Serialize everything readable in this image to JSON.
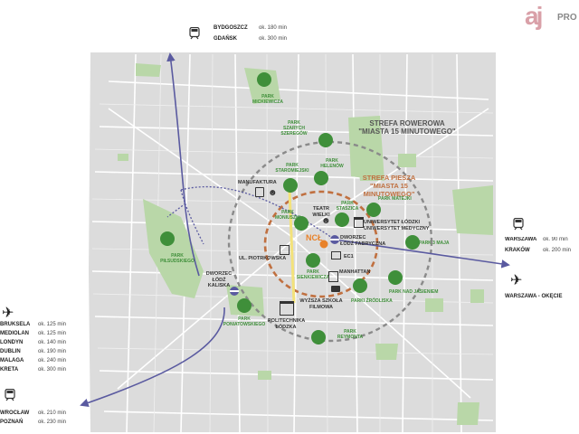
{
  "brand": {
    "logo_letters": "aj",
    "text": "PRO"
  },
  "colors": {
    "accent": "#5a5aa0",
    "logo": "#d9a0a8",
    "park_green": "#3f8f3a",
    "bike_zone": "#8a8a8a",
    "walk_zone": "#c07040",
    "center": "#e8822a"
  },
  "zones": {
    "bike": {
      "line1": "STREFA ROWEROWA",
      "line2": "\"MIASTA 15 MINUTOWEGO\""
    },
    "walk": {
      "line1": "STREFA PIESZA",
      "line2": "\"MIASTA 15 MINUTOWEGO\""
    }
  },
  "center_label": "NCŁ",
  "parks": {
    "mickiewicza": [
      "PARK",
      "MICKIEWICZA"
    ],
    "szarych": [
      "PARK",
      "SZARYCH SZEREGÓW"
    ],
    "staromiejski": [
      "PARK",
      "STAROMIEJSKI"
    ],
    "helenow": [
      "PARK",
      "HELENÓW"
    ],
    "matejki": "PARK MATEJKI",
    "staszica": [
      "PARK",
      "STASZICA"
    ],
    "moniuszki": [
      "PARK",
      "MONIUSZKI"
    ],
    "poniatowskiego": [
      "PARK",
      "PONIATOWSKIEGO"
    ],
    "sienkiewicza": [
      "PARK",
      "SIENKIEWICZA"
    ],
    "trzeciego_maja": "PARK 3 MAJA",
    "zrodliska": "PARKI ŹRÓDLISKA",
    "jesienem": "PARK NAD JASIENIEM",
    "reymonta": [
      "PARK",
      "REYMONTA"
    ],
    "pilsudskiego": [
      "PARK",
      "PIŁSUDSKIEGO"
    ]
  },
  "pois": {
    "manufaktura": "MANUFAKTURA",
    "teatr": [
      "TEATR",
      "WIELKI"
    ],
    "uniwersytet": [
      "UNIWERSYTET ŁÓDZKI",
      "UNIWERSYTET MEDYCZNY"
    ],
    "dworzec_fabryczna": [
      "DWORZEC",
      "ŁÓDŹ FABRYCZNA"
    ],
    "ec1": "EC1",
    "piotrkowska": "UL. PIOTRKOWSKA",
    "manhattan": "MANHATTAN",
    "dworzec_kaliska": [
      "DWORZEC",
      "ŁÓDŹ KALISKA"
    ],
    "szkola_filmowa": [
      "WYŻSZA SZKOŁA",
      "FILMOWA"
    ],
    "politechnika": [
      "POLITECHNIKA",
      "ŁÓDZKA"
    ]
  },
  "north_train": [
    {
      "city": "BYDGOSZCZ",
      "time": "ok. 180 min"
    },
    {
      "city": "GDAŃSK",
      "time": "ok. 300 min"
    }
  ],
  "east_train": [
    {
      "city": "WARSZAWA",
      "time": "ok. 90 min"
    },
    {
      "city": "KRAKÓW",
      "time": "ok. 200 min"
    }
  ],
  "east_air": "WARSZAWA - OKĘCIE",
  "west_air": [
    {
      "city": "BRUKSELA",
      "time": "ok. 125 min"
    },
    {
      "city": "MEDIOLAN",
      "time": "ok. 125 min"
    },
    {
      "city": "LONDYN",
      "time": "ok. 140 min"
    },
    {
      "city": "DUBLIN",
      "time": "ok. 190 min"
    },
    {
      "city": "MALAGA",
      "time": "ok. 240 min"
    },
    {
      "city": "KRETA",
      "time": "ok. 300 min"
    }
  ],
  "west_train": [
    {
      "city": "WROCŁAW",
      "time": "ok. 210 min"
    },
    {
      "city": "POZNAŃ",
      "time": "ok. 230 min"
    }
  ]
}
